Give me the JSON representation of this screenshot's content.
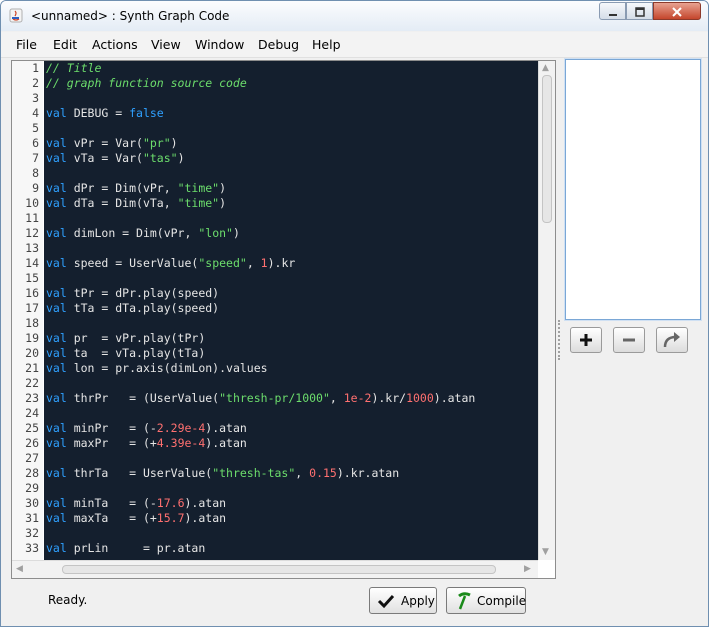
{
  "window": {
    "title": "<unnamed> : Synth Graph Code"
  },
  "menu": [
    "File",
    "Edit",
    "Actions",
    "View",
    "Window",
    "Debug",
    "Help"
  ],
  "colors": {
    "editor_bg": "#141f2e",
    "keyword": "#2fa0ff",
    "string": "#6cdd6c",
    "number": "#ff7070",
    "comment": "#6cdd6c",
    "plain": "#e6e6e6"
  },
  "editor": {
    "lines": [
      [
        [
          "cm",
          "// Title"
        ]
      ],
      [
        [
          "cm",
          "// graph function source code"
        ]
      ],
      [],
      [
        [
          "kw",
          "val"
        ],
        [
          "t",
          " DEBUG = "
        ],
        [
          "kw",
          "false"
        ]
      ],
      [],
      [
        [
          "kw",
          "val"
        ],
        [
          "t",
          " vPr = Var("
        ],
        [
          "str",
          "\"pr\""
        ],
        [
          "t",
          ")"
        ]
      ],
      [
        [
          "kw",
          "val"
        ],
        [
          "t",
          " vTa = Var("
        ],
        [
          "str",
          "\"tas\""
        ],
        [
          "t",
          ")"
        ]
      ],
      [],
      [
        [
          "kw",
          "val"
        ],
        [
          "t",
          " dPr = Dim(vPr, "
        ],
        [
          "str",
          "\"time\""
        ],
        [
          "t",
          ")"
        ]
      ],
      [
        [
          "kw",
          "val"
        ],
        [
          "t",
          " dTa = Dim(vTa, "
        ],
        [
          "str",
          "\"time\""
        ],
        [
          "t",
          ")"
        ]
      ],
      [],
      [
        [
          "kw",
          "val"
        ],
        [
          "t",
          " dimLon = Dim(vPr, "
        ],
        [
          "str",
          "\"lon\""
        ],
        [
          "t",
          ")"
        ]
      ],
      [],
      [
        [
          "kw",
          "val"
        ],
        [
          "t",
          " speed = UserValue("
        ],
        [
          "str",
          "\"speed\""
        ],
        [
          "t",
          ", "
        ],
        [
          "num",
          "1"
        ],
        [
          "t",
          ").kr"
        ]
      ],
      [],
      [
        [
          "kw",
          "val"
        ],
        [
          "t",
          " tPr = dPr.play(speed)"
        ]
      ],
      [
        [
          "kw",
          "val"
        ],
        [
          "t",
          " tTa = dTa.play(speed)"
        ]
      ],
      [],
      [
        [
          "kw",
          "val"
        ],
        [
          "t",
          " pr  = vPr.play(tPr)"
        ]
      ],
      [
        [
          "kw",
          "val"
        ],
        [
          "t",
          " ta  = vTa.play(tTa)"
        ]
      ],
      [
        [
          "kw",
          "val"
        ],
        [
          "t",
          " lon = pr.axis(dimLon).values"
        ]
      ],
      [],
      [
        [
          "kw",
          "val"
        ],
        [
          "t",
          " thrPr   = (UserValue("
        ],
        [
          "str",
          "\"thresh-pr/1000\""
        ],
        [
          "t",
          ", "
        ],
        [
          "num",
          "1e-2"
        ],
        [
          "t",
          ").kr/"
        ],
        [
          "num",
          "1000"
        ],
        [
          "t",
          ").atan"
        ]
      ],
      [],
      [
        [
          "kw",
          "val"
        ],
        [
          "t",
          " minPr   = (-"
        ],
        [
          "num",
          "2.29e-4"
        ],
        [
          "t",
          ").atan"
        ]
      ],
      [
        [
          "kw",
          "val"
        ],
        [
          "t",
          " maxPr   = (+"
        ],
        [
          "num",
          "4.39e-4"
        ],
        [
          "t",
          ").atan"
        ]
      ],
      [],
      [
        [
          "kw",
          "val"
        ],
        [
          "t",
          " thrTa   = UserValue("
        ],
        [
          "str",
          "\"thresh-tas\""
        ],
        [
          "t",
          ", "
        ],
        [
          "num",
          "0.15"
        ],
        [
          "t",
          ").kr.atan"
        ]
      ],
      [],
      [
        [
          "kw",
          "val"
        ],
        [
          "t",
          " minTa   = (-"
        ],
        [
          "num",
          "17.6"
        ],
        [
          "t",
          ").atan"
        ]
      ],
      [
        [
          "kw",
          "val"
        ],
        [
          "t",
          " maxTa   = (+"
        ],
        [
          "num",
          "15.7"
        ],
        [
          "t",
          ").atan"
        ]
      ],
      [],
      [
        [
          "kw",
          "val"
        ],
        [
          "t",
          " prLin     = pr.atan"
        ]
      ]
    ]
  },
  "footer": {
    "status": "Ready.",
    "apply_label": "Apply",
    "compile_label": "Compile"
  }
}
